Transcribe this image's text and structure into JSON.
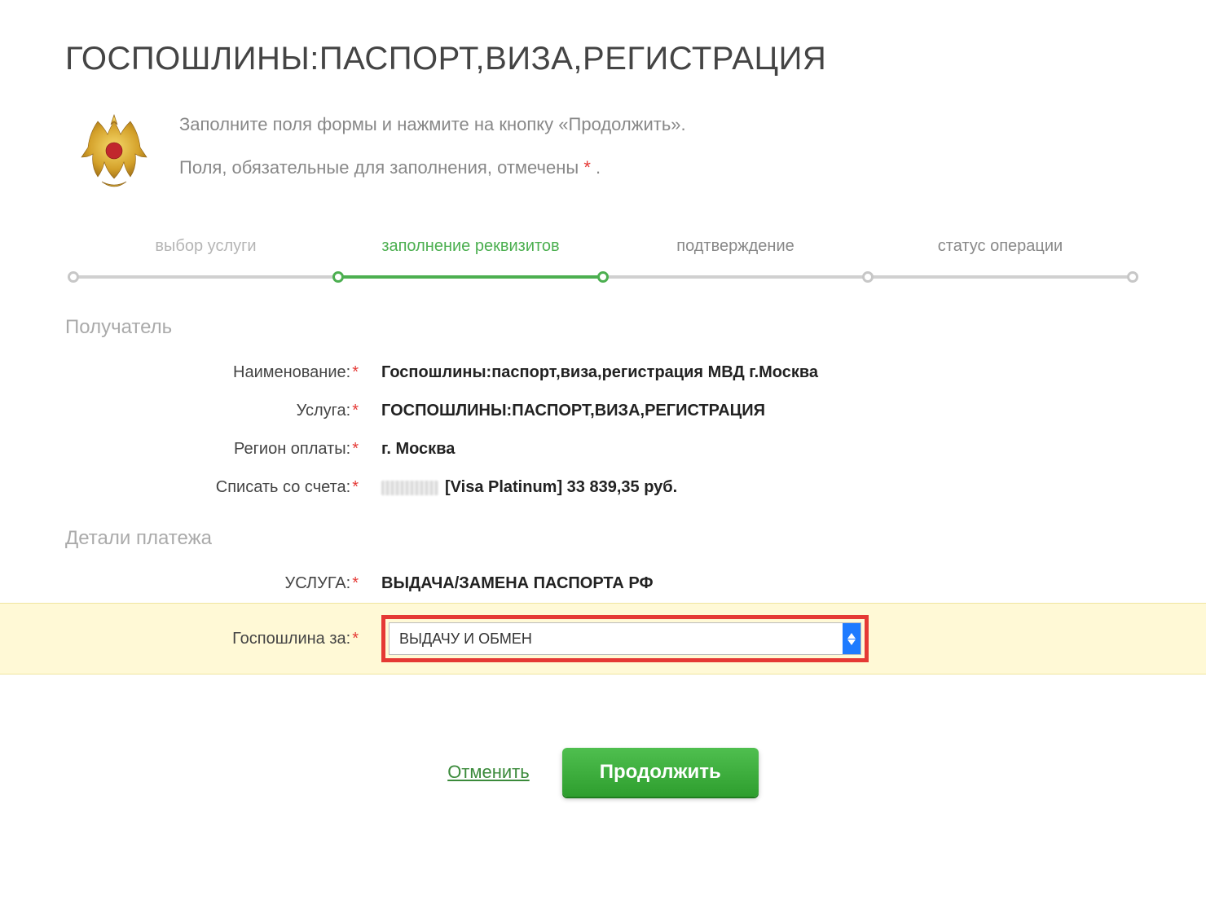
{
  "title": "ГОСПОШЛИНЫ:ПАСПОРТ,ВИЗА,РЕГИСТРАЦИЯ",
  "intro": {
    "line1": "Заполните поля формы и нажмите на кнопку «Продолжить».",
    "line2_pre": "Поля, обязательные для заполнения, отмечены ",
    "line2_post": " ."
  },
  "stepper": {
    "steps": [
      {
        "label": "выбор услуги"
      },
      {
        "label": "заполнение реквизитов"
      },
      {
        "label": "подтверждение"
      },
      {
        "label": "статус операции"
      }
    ],
    "active_index": 1
  },
  "recipient": {
    "section_title": "Получатель",
    "name_label": "Наименование:",
    "name_value": "Госпошлины:паспорт,виза,регистрация МВД г.Москва",
    "service_label": "Услуга:",
    "service_value": "ГОСПОШЛИНЫ:ПАСПОРТ,ВИЗА,РЕГИСТРАЦИЯ",
    "region_label": "Регион оплаты:",
    "region_value": "г. Москва",
    "account_label": "Списать со счета:",
    "account_value": "[Visa Platinum] 33 839,35   руб."
  },
  "details": {
    "section_title": "Детали платежа",
    "service_label": "УСЛУГА:",
    "service_value": "ВЫДАЧА/ЗАМЕНА ПАСПОРТА РФ",
    "fee_label": "Госпошлина за:",
    "fee_selected": "ВЫДАЧУ И ОБМЕН"
  },
  "actions": {
    "cancel": "Отменить",
    "continue": "Продолжить"
  }
}
